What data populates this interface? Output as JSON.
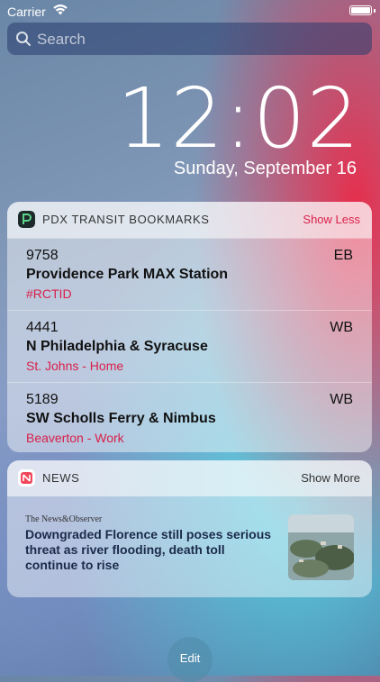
{
  "status_bar": {
    "carrier": "Carrier",
    "battery_level": 1.0
  },
  "search": {
    "placeholder": "Search"
  },
  "lock_screen": {
    "time": "12:02",
    "date": "Sunday, September 16"
  },
  "transit_widget": {
    "title": "PDX TRANSIT BOOKMARKS",
    "action": "Show Less",
    "accent_color": "#d8204a",
    "bookmarks": [
      {
        "stop_id": "9758",
        "direction": "EB",
        "name": "Providence Park MAX Station",
        "tag": "#RCTID"
      },
      {
        "stop_id": "4441",
        "direction": "WB",
        "name": "N Philadelphia & Syracuse",
        "tag": "St. Johns - Home"
      },
      {
        "stop_id": "5189",
        "direction": "WB",
        "name": "SW Scholls Ferry & Nimbus",
        "tag": "Beaverton - Work"
      }
    ]
  },
  "news_widget": {
    "title": "NEWS",
    "action": "Show More",
    "publisher": "The News&Observer",
    "headline": "Downgraded Florence still poses serious threat as river flooding, death toll continue to rise"
  },
  "edit_label": "Edit"
}
